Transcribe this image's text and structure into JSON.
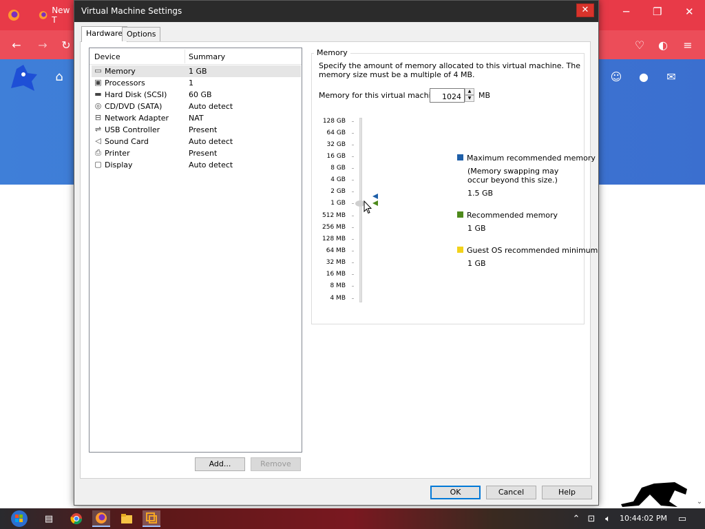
{
  "browser": {
    "tab_new_label": "New T",
    "header_icons": [
      "home-icon",
      "discord-icon",
      "github-icon",
      "mail-icon"
    ]
  },
  "dialog": {
    "title": "Virtual Machine Settings",
    "close_label": "✕",
    "tabs": [
      {
        "label": "Hardware",
        "active": true
      },
      {
        "label": "Options",
        "active": false
      }
    ],
    "device_list": {
      "headers": {
        "device": "Device",
        "summary": "Summary"
      },
      "rows": [
        {
          "icon": "memory-icon",
          "glyph": "▭",
          "name": "Memory",
          "summary": "1 GB",
          "selected": true
        },
        {
          "icon": "processor-icon",
          "glyph": "▣",
          "name": "Processors",
          "summary": "1",
          "selected": false
        },
        {
          "icon": "hard-disk-icon",
          "glyph": "▬",
          "name": "Hard Disk (SCSI)",
          "summary": "60 GB",
          "selected": false
        },
        {
          "icon": "cd-dvd-icon",
          "glyph": "◎",
          "name": "CD/DVD (SATA)",
          "summary": "Auto detect",
          "selected": false
        },
        {
          "icon": "network-adapter-icon",
          "glyph": "⊟",
          "name": "Network Adapter",
          "summary": "NAT",
          "selected": false
        },
        {
          "icon": "usb-icon",
          "glyph": "⇌",
          "name": "USB Controller",
          "summary": "Present",
          "selected": false
        },
        {
          "icon": "speaker-icon",
          "glyph": "◁",
          "name": "Sound Card",
          "summary": "Auto detect",
          "selected": false
        },
        {
          "icon": "printer-icon",
          "glyph": "⎙",
          "name": "Printer",
          "summary": "Present",
          "selected": false
        },
        {
          "icon": "display-icon",
          "glyph": "▢",
          "name": "Display",
          "summary": "Auto detect",
          "selected": false
        }
      ]
    },
    "buttons": {
      "add": "Add...",
      "remove": "Remove",
      "ok": "OK",
      "cancel": "Cancel",
      "help": "Help"
    },
    "memory": {
      "group_label": "Memory",
      "description": "Specify the amount of memory allocated to this virtual machine. The memory size must be a multiple of 4 MB.",
      "field_label": "Memory for this virtual machine:",
      "value": "1024",
      "unit": "MB",
      "scale": [
        "128 GB",
        "64 GB",
        "32 GB",
        "16 GB",
        "8 GB",
        "4 GB",
        "2 GB",
        "1 GB",
        "512 MB",
        "256 MB",
        "128 MB",
        "64 MB",
        "32 MB",
        "16 MB",
        "8 MB",
        "4 MB"
      ],
      "legend": {
        "max_label": "Maximum recommended memory",
        "max_note_line1": "(Memory swapping may",
        "max_note_line2": "occur beyond this size.)",
        "max_value": "1.5 GB",
        "rec_label": "Recommended memory",
        "rec_value": "1 GB",
        "guest_label": "Guest OS recommended minimum",
        "guest_value": "1 GB"
      },
      "colors": {
        "max": "#1e5fa8",
        "recommended": "#4e8a1c",
        "guest": "#f2d21b"
      }
    }
  },
  "taskbar": {
    "clock": "10:44:02 PM"
  }
}
